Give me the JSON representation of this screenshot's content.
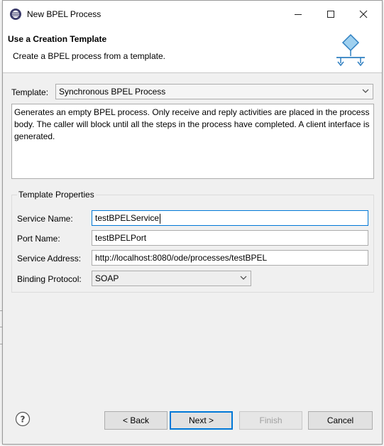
{
  "window": {
    "title": "New BPEL Process"
  },
  "header": {
    "title": "Use a Creation Template",
    "description": "Create a BPEL process from a template."
  },
  "template": {
    "label": "Template:",
    "selected": "Synchronous BPEL Process",
    "description": "Generates an empty BPEL process. Only receive and reply activities are placed in the process body. The caller will block until all the steps in the process have completed. A client interface is generated."
  },
  "properties": {
    "group_label": "Template Properties",
    "service_name_label": "Service Name:",
    "service_name_value": "testBPELService",
    "port_name_label": "Port Name:",
    "port_name_value": "testBPELPort",
    "service_address_label": "Service Address:",
    "service_address_value": "http://localhost:8080/ode/processes/testBPEL",
    "binding_protocol_label": "Binding Protocol:",
    "binding_protocol_value": "SOAP"
  },
  "buttons": {
    "back_label": "< Back",
    "next_label": "Next >",
    "finish_label": "Finish",
    "cancel_label": "Cancel"
  },
  "icons": {
    "app": "eclipse-icon",
    "header": "bpel-process-wizard-icon",
    "help": "help-icon",
    "minimize": "minimize-icon",
    "maximize": "maximize-icon",
    "close": "close-icon"
  },
  "colors": {
    "focus_accent": "#0078d7",
    "window_bg": "#f0f0f0",
    "icon_blue": "#2e7fc1"
  }
}
